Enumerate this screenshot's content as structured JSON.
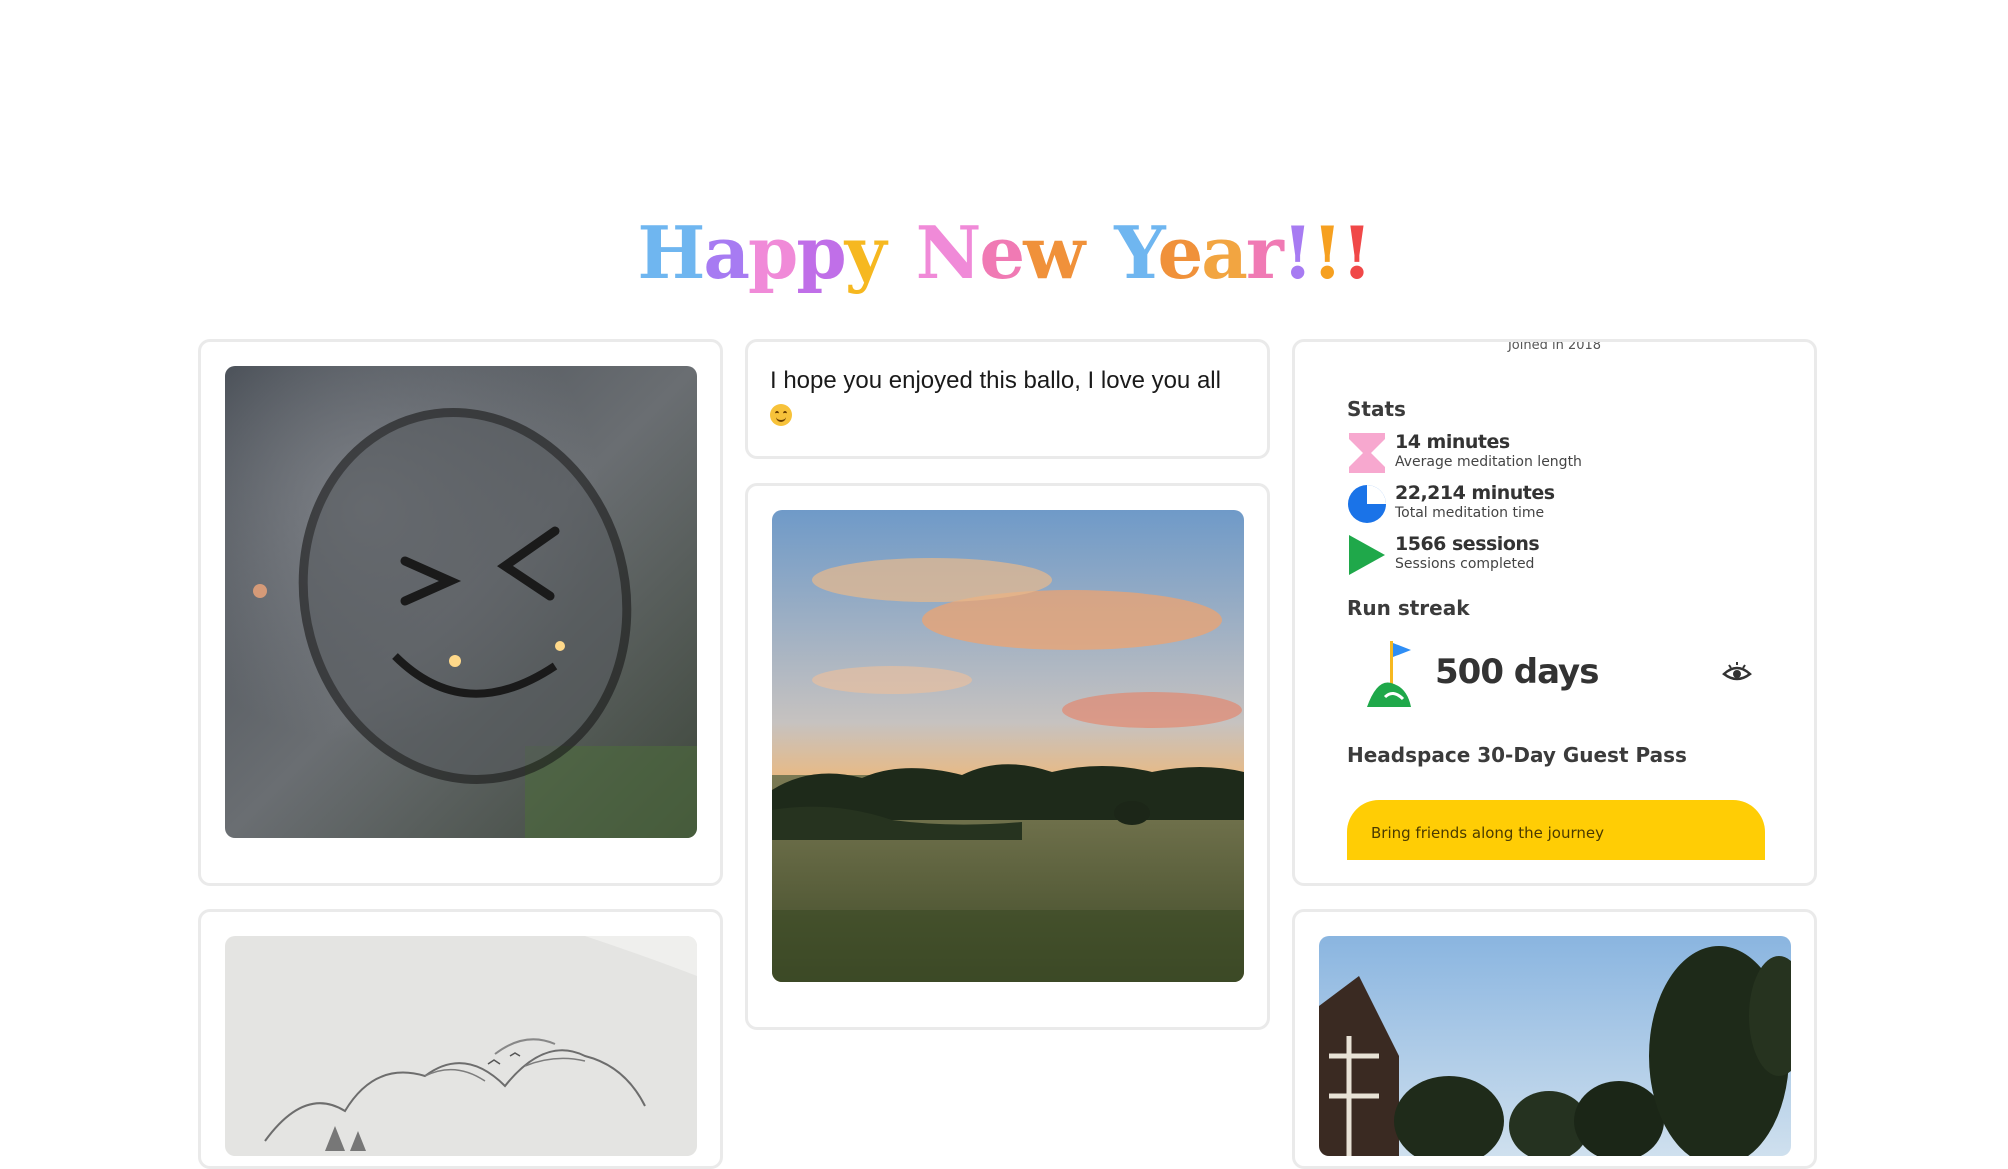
{
  "page": {
    "title_segments": [
      {
        "text": "H",
        "color": "#6fb6f0"
      },
      {
        "text": "a",
        "color": "#a77bf2"
      },
      {
        "text": "p",
        "color": "#f08ad8"
      },
      {
        "text": "p",
        "color": "#c06fe8"
      },
      {
        "text": "y",
        "color": "#f6b820"
      },
      {
        "text": " ",
        "color": "#000000"
      },
      {
        "text": "N",
        "color": "#f08ad8"
      },
      {
        "text": "e",
        "color": "#f07ab4"
      },
      {
        "text": "w",
        "color": "#f0913a"
      },
      {
        "text": " ",
        "color": "#000000"
      },
      {
        "text": "Y",
        "color": "#6fb6f0"
      },
      {
        "text": "e",
        "color": "#f0913a"
      },
      {
        "text": "a",
        "color": "#f2a541"
      },
      {
        "text": "r",
        "color": "#f07ab4"
      },
      {
        "text": "!",
        "color": "#a77bf2"
      },
      {
        "text": "!",
        "color": "#f6a020"
      },
      {
        "text": "!",
        "color": "#f04848"
      }
    ]
  },
  "message_card": {
    "text": "I hope you enjoyed this ballo, I love you all"
  },
  "headspace": {
    "joined": "Joined in 2018",
    "stats_heading": "Stats",
    "stats": [
      {
        "value": "14 minutes",
        "label": "Average meditation length",
        "icon": "hourglass-icon",
        "color": "#f7a8cf"
      },
      {
        "value": "22,214 minutes",
        "label": "Total meditation time",
        "icon": "pie-icon",
        "color": "#1a73e8"
      },
      {
        "value": "1566 sessions",
        "label": "Sessions completed",
        "icon": "play-icon",
        "color": "#1fa84a"
      }
    ],
    "streak_heading": "Run streak",
    "streak_value": "500 days",
    "guest_pass_heading": "Headspace 30-Day Guest Pass",
    "cta_text": "Bring friends along the journey",
    "accent": "#ffcd05"
  },
  "photos": [
    {
      "name": "photo-smiley-window",
      "icon": "smiley-window-photo"
    },
    {
      "name": "photo-sunset-field",
      "icon": "sunset-photo"
    },
    {
      "name": "photo-pencil-sketch",
      "icon": "sketch-photo"
    },
    {
      "name": "photo-house-trees",
      "icon": "house-photo"
    }
  ]
}
